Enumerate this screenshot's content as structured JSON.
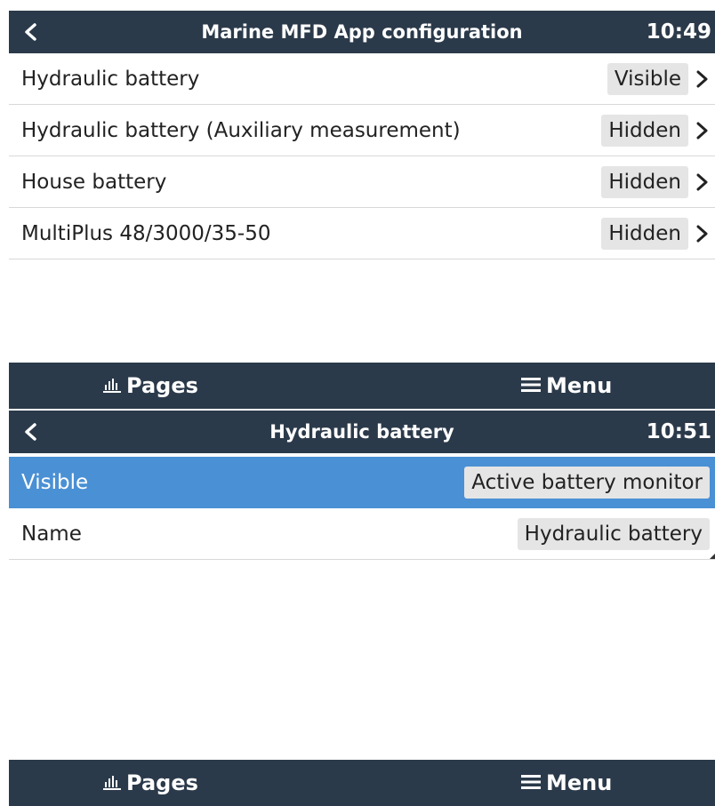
{
  "screen1": {
    "title": "Marine MFD App configuration",
    "time": "10:49",
    "items": [
      {
        "label": "Hydraulic battery",
        "value": "Visible"
      },
      {
        "label": "Hydraulic battery (Auxiliary measurement)",
        "value": "Hidden"
      },
      {
        "label": "House battery",
        "value": "Hidden"
      },
      {
        "label": "MultiPlus 48/3000/35-50",
        "value": "Hidden"
      }
    ],
    "footer": {
      "pages_label": "Pages",
      "menu_label": "Menu"
    }
  },
  "screen2": {
    "title": "Hydraulic battery",
    "time": "10:51",
    "items": [
      {
        "label": "Visible",
        "value": "Active battery monitor"
      },
      {
        "label": "Name",
        "value": "Hydraulic battery"
      }
    ],
    "footer": {
      "pages_label": "Pages",
      "menu_label": "Menu"
    }
  },
  "icons": {
    "back": "chevron-left-icon",
    "row_arrow": "chevron-right-icon",
    "pages": "bar-chart-icon",
    "menu": "hamburger-menu-icon"
  },
  "colors": {
    "header": "#2b3a4a",
    "selected_row": "#4a90d4",
    "value_bg": "#e5e5e5"
  }
}
